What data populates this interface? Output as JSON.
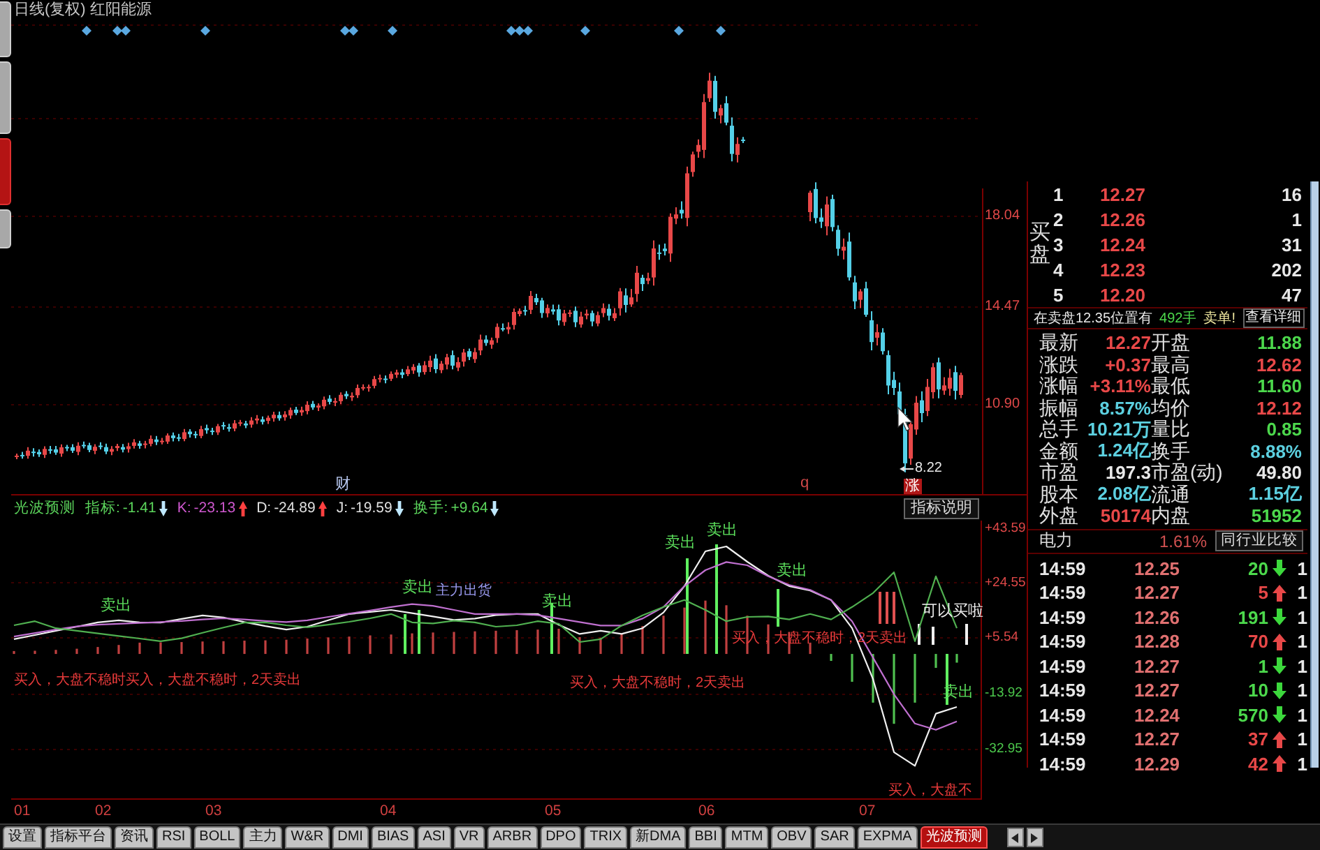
{
  "side_tabs": [
    {
      "selected": false
    },
    {
      "selected": false
    },
    {
      "selected": true
    },
    {
      "selected": false
    }
  ],
  "price_chart": {
    "title": "日线(复权) 红阳能源",
    "axis_labels": [
      "18.04",
      "14.47",
      "10.90"
    ],
    "event_labels": [
      {
        "text": "财",
        "color": "#b8c8f0"
      },
      {
        "text": "q",
        "color": "#d04848"
      }
    ],
    "rise_tag": "涨",
    "low_label": "8.22"
  },
  "indicator": {
    "name": "光波预测",
    "readouts": [
      {
        "label": "指标:",
        "value": "-1.41",
        "rising": false,
        "color": "#5cd65c"
      },
      {
        "label": "K:",
        "value": "-23.13",
        "rising": true,
        "color": "#d058d0"
      },
      {
        "label": "D:",
        "value": "-24.89",
        "rising": true,
        "color": "#e0e0e0"
      },
      {
        "label": "J:",
        "value": "-19.59",
        "rising": false,
        "color": "#e0e0e0"
      },
      {
        "label": "换手:",
        "value": "+9.64",
        "rising": false,
        "color": "#5cd65c"
      }
    ],
    "help_button": "指标说明",
    "chart_data": {
      "type": "line",
      "ylim": [
        -50.3,
        46.0
      ],
      "grid": true,
      "yticks": [
        {
          "value": 43.59,
          "label": "+43.59"
        },
        {
          "value": 24.55,
          "label": "+24.55"
        },
        {
          "value": 5.54,
          "label": "+5.54"
        },
        {
          "value": -13.92,
          "label": "-13.92"
        },
        {
          "value": -32.95,
          "label": "-32.95"
        }
      ],
      "series": [
        {
          "color": "#f0f0f0",
          "values": [
            5.1,
            6.5,
            8.0,
            9.4,
            10.9,
            11.6,
            10.9,
            10.8,
            12.1,
            13.3,
            12.6,
            11.0,
            9.6,
            8.4,
            9.4,
            11.6,
            13.8,
            14.5,
            15.2,
            14.1,
            12.9,
            11.7,
            12.2,
            13.4,
            13.8,
            13.8,
            10.1,
            6.9,
            8.0,
            6.9,
            8.9,
            14.3,
            23.4,
            35.4,
            37.1,
            31.8,
            27.0,
            23.4,
            21.9,
            18.6,
            8.9,
            -8.7,
            -33.9,
            -38.6,
            -20.6,
            -18.3
          ]
        },
        {
          "color": "#c070d0",
          "values": [
            6.0,
            7.2,
            8.4,
            9.5,
            10.1,
            10.4,
            10.7,
            11.0,
            11.4,
            11.9,
            12.3,
            11.9,
            11.4,
            11.0,
            11.6,
            12.8,
            13.9,
            15.0,
            16.2,
            17.2,
            16.6,
            15.2,
            13.8,
            13.8,
            13.8,
            13.4,
            12.2,
            11.0,
            9.8,
            9.8,
            12.2,
            16.2,
            23.4,
            28.9,
            31.7,
            30.6,
            26.8,
            23.8,
            22.1,
            18.6,
            11.3,
            -1.3,
            -13.9,
            -24.0,
            -26.2,
            -23.3
          ]
        },
        {
          "color": "#50b050",
          "values": [
            9.9,
            11.3,
            8.9,
            8.0,
            7.1,
            6.2,
            5.3,
            4.4,
            5.4,
            7.3,
            9.1,
            10.8,
            10.9,
            9.9,
            9.2,
            10.1,
            11.1,
            12.3,
            13.8,
            10.9,
            10.5,
            11.5,
            10.9,
            9.4,
            9.9,
            11.3,
            10.4,
            4.1,
            5.1,
            9.8,
            13.3,
            16.2,
            18.6,
            15.2,
            11.3,
            12.8,
            12.9,
            11.9,
            13.8,
            11.9,
            16.2,
            21.0,
            28.2,
            4.4,
            26.8,
            8.9
          ]
        },
        {
          "type": "bar",
          "color": "#c04040",
          "values": [
            1.0,
            1.1,
            1.4,
            1.8,
            2.4,
            3.1,
            3.9,
            4.0,
            4.1,
            4.3,
            4.4,
            4.6,
            4.7,
            4.9,
            5.3,
            5.7,
            6.0,
            6.4,
            6.7,
            7.1,
            7.4,
            7.6,
            7.8,
            8.0,
            8.2,
            8.4,
            8.7,
            5.8,
            5.6,
            6.8,
            9.6,
            13.2,
            16.0,
            18.4,
            16.8,
            13.2,
            10.2,
            7.6,
            3.9,
            null,
            null,
            null,
            null,
            null,
            null,
            null
          ]
        },
        {
          "type": "bar",
          "color": "#50c050",
          "values": [
            null,
            null,
            null,
            null,
            null,
            null,
            null,
            null,
            null,
            null,
            null,
            null,
            null,
            null,
            null,
            null,
            null,
            null,
            null,
            null,
            null,
            null,
            null,
            null,
            null,
            null,
            null,
            null,
            null,
            null,
            null,
            null,
            null,
            null,
            null,
            null,
            null,
            null,
            null,
            -2.4,
            -9.6,
            -16.8,
            -24.1,
            -16.8,
            -4.8,
            -3.0
          ]
        }
      ]
    },
    "annotations": [
      {
        "kind": "sell",
        "text": "卖出"
      },
      {
        "kind": "sell",
        "text": "卖出"
      },
      {
        "kind": "main",
        "text": "主力出货"
      },
      {
        "kind": "sell",
        "text": "卖出"
      },
      {
        "kind": "sell",
        "text": "卖出"
      },
      {
        "kind": "sell",
        "text": "卖出"
      },
      {
        "kind": "sell",
        "text": "卖出"
      },
      {
        "kind": "sell",
        "text": "卖出"
      },
      {
        "kind": "buy",
        "text": "买入，大盘不稳时买入，大盘不稳时，2天卖出"
      },
      {
        "kind": "buy",
        "text": "买入，大盘不稳时，2天卖出"
      },
      {
        "kind": "buy",
        "text": "买入，大盘不稳时，2天卖出"
      },
      {
        "kind": "hint",
        "text": "可以买啦"
      },
      {
        "kind": "buy",
        "text": "买入，大盘不"
      }
    ]
  },
  "dates": [
    "01",
    "02",
    "03",
    "04",
    "05",
    "06",
    "07"
  ],
  "bottom_tabs": [
    {
      "label": "设置",
      "selected": false
    },
    {
      "label": "指标平台",
      "selected": false
    },
    {
      "label": "资讯",
      "selected": false
    },
    {
      "label": "RSI",
      "selected": false
    },
    {
      "label": "BOLL",
      "selected": false
    },
    {
      "label": "主力",
      "selected": false
    },
    {
      "label": "W&R",
      "selected": false
    },
    {
      "label": "DMI",
      "selected": false
    },
    {
      "label": "BIAS",
      "selected": false
    },
    {
      "label": "ASI",
      "selected": false
    },
    {
      "label": "VR",
      "selected": false
    },
    {
      "label": "ARBR",
      "selected": false
    },
    {
      "label": "DPO",
      "selected": false
    },
    {
      "label": "TRIX",
      "selected": false
    },
    {
      "label": "新DMA",
      "selected": false
    },
    {
      "label": "BBI",
      "selected": false
    },
    {
      "label": "MTM",
      "selected": false
    },
    {
      "label": "OBV",
      "selected": false
    },
    {
      "label": "SAR",
      "selected": false
    },
    {
      "label": "EXPMA",
      "selected": false
    },
    {
      "label": "光波预测",
      "selected": true
    }
  ],
  "order_book": {
    "side_label": "买盘",
    "levels": [
      {
        "num": "1",
        "price": "12.27",
        "volume": "16"
      },
      {
        "num": "2",
        "price": "12.26",
        "volume": "1"
      },
      {
        "num": "3",
        "price": "12.24",
        "volume": "31"
      },
      {
        "num": "4",
        "price": "12.23",
        "volume": "202"
      },
      {
        "num": "5",
        "price": "12.20",
        "volume": "47"
      }
    ]
  },
  "notice": {
    "text": "在卖盘12.35位置有",
    "volume": "492手",
    "flag": "卖单!",
    "link": "查看详细"
  },
  "quotes": [
    {
      "label": "最新",
      "value": "12.27",
      "color": "#e84848"
    },
    {
      "label": "开盘",
      "value": "11.88",
      "color": "#4cd84c"
    },
    {
      "label": "涨跌",
      "value": "+0.37",
      "color": "#e84848"
    },
    {
      "label": "最高",
      "value": "12.62",
      "color": "#e84848"
    },
    {
      "label": "涨幅",
      "value": "+3.11%",
      "color": "#e84848"
    },
    {
      "label": "最低",
      "value": "11.60",
      "color": "#4cd84c"
    },
    {
      "label": "振幅",
      "value": "8.57%",
      "color": "#5cd0e0"
    },
    {
      "label": "均价",
      "value": "12.12",
      "color": "#e84848"
    },
    {
      "label": "总手",
      "value": "10.21万",
      "color": "#5cd0e0"
    },
    {
      "label": "量比",
      "value": "0.85",
      "color": "#4cd84c"
    },
    {
      "label": "金额",
      "value": "1.24亿",
      "color": "#5cd0e0"
    },
    {
      "label": "换手",
      "value": "8.88%",
      "color": "#5cd0e0"
    },
    {
      "label": "市盈",
      "value": "197.3",
      "color": "#e8e8e8"
    },
    {
      "label": "市盈(动)",
      "value": "49.80",
      "color": "#e8e8e8"
    },
    {
      "label": "股本",
      "value": "2.08亿",
      "color": "#5cd0e0"
    },
    {
      "label": "流通",
      "value": "1.15亿",
      "color": "#5cd0e0"
    },
    {
      "label": "外盘",
      "value": "50174",
      "color": "#e84848"
    },
    {
      "label": "内盘",
      "value": "51952",
      "color": "#4cd84c"
    }
  ],
  "sector": {
    "name": "电力",
    "change": "1.61%",
    "compare_button": "同行业比较"
  },
  "ticks": [
    {
      "time": "14:59",
      "price": "12.25",
      "volume": "20",
      "rising": false,
      "column_4": "1"
    },
    {
      "time": "14:59",
      "price": "12.27",
      "volume": "5",
      "rising": true,
      "column_4": "1"
    },
    {
      "time": "14:59",
      "price": "12.26",
      "volume": "191",
      "rising": false,
      "column_4": "1"
    },
    {
      "time": "14:59",
      "price": "12.28",
      "volume": "70",
      "rising": true,
      "column_4": "1"
    },
    {
      "time": "14:59",
      "price": "12.27",
      "volume": "1",
      "rising": false,
      "column_4": "1"
    },
    {
      "time": "14:59",
      "price": "12.27",
      "volume": "10",
      "rising": false,
      "column_4": "1"
    },
    {
      "time": "14:59",
      "price": "12.24",
      "volume": "570",
      "rising": false,
      "column_4": "1"
    },
    {
      "time": "14:59",
      "price": "12.27",
      "volume": "37",
      "rising": true,
      "column_4": "1"
    },
    {
      "time": "14:59",
      "price": "12.29",
      "volume": "42",
      "rising": true,
      "column_4": "1"
    }
  ]
}
